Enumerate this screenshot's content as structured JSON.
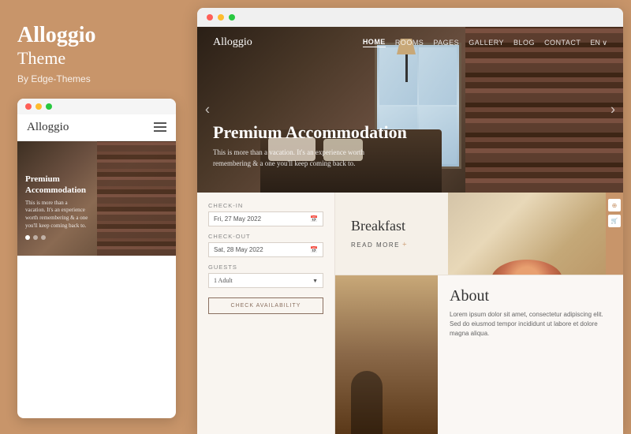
{
  "brand": {
    "title": "Alloggio",
    "subtitle": "Theme",
    "by": "By Edge-Themes"
  },
  "mobile": {
    "logo": "Alloggio",
    "hero_title": "Premium\nAccommodation",
    "hero_desc": "This is more than a vacation. It's an experience worth remembering & a one you'll keep coming back to."
  },
  "nav": {
    "logo": "Alloggio",
    "links": [
      "HOME",
      "ROOMS",
      "PAGES",
      "GALLERY",
      "BLOG",
      "CONTACT"
    ],
    "lang": "EN ∨"
  },
  "hero": {
    "title": "Premium Accommodation",
    "desc": "This is more than a vacation. It's an experience worth remembering & a one you'll keep coming back to."
  },
  "booking": {
    "checkin_label": "CHECK-IN",
    "checkin_value": "Fri, 27 May 2022",
    "checkout_label": "CHECK-OUT",
    "checkout_value": "Sat, 28 May 2022",
    "guests_label": "GUESTS",
    "guests_value": "1 Adult",
    "button_label": "CHECK AVAILABILITY"
  },
  "breakfast": {
    "title": "Breakfast",
    "link": "READ MORE",
    "arrow": "+"
  },
  "about": {
    "title": "About",
    "text": "Lorem ipsum dolor sit amet, consectetur adipiscing elit. Sed do eiusmod tempor incididunt ut labore et dolore magna aliqua."
  },
  "sidebar_icons": {
    "icon1": "⊕",
    "icon2": "🛒"
  },
  "colors": {
    "brand_bg": "#c8956a",
    "accent": "#c8956a",
    "dark": "#2a1f16",
    "light_bg": "#f9f5f0"
  }
}
